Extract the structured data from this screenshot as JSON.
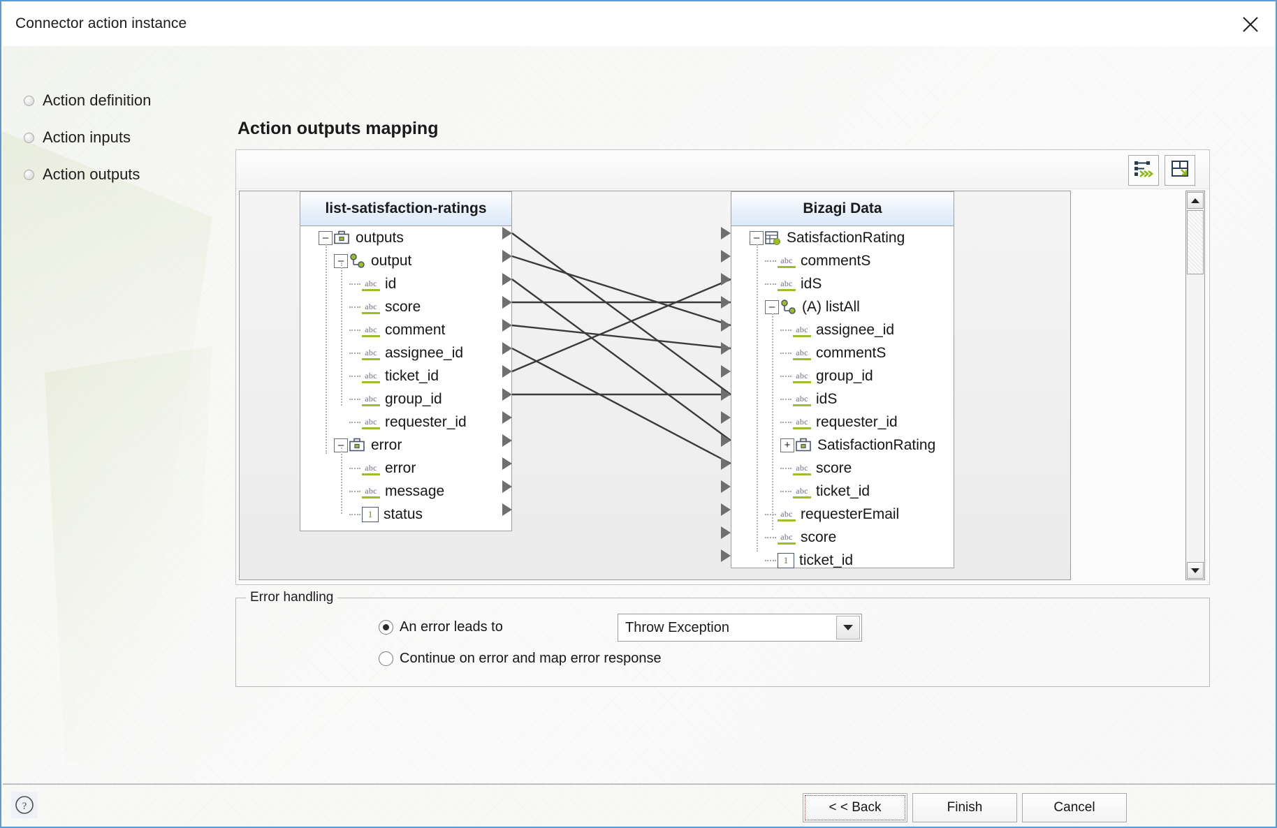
{
  "window": {
    "title": "Connector action instance",
    "close_icon": "close-icon"
  },
  "wizard_nav": {
    "items": [
      {
        "label": "Action definition"
      },
      {
        "label": "Action inputs"
      },
      {
        "label": "Action outputs"
      }
    ]
  },
  "page": {
    "title": "Action outputs mapping"
  },
  "mapper_toolbar": {
    "buttons": [
      {
        "icon": "auto-map-icon",
        "label": ""
      },
      {
        "icon": "fit-to-window-icon",
        "label": ""
      }
    ]
  },
  "source_tree": {
    "header": "list-satisfaction-ratings",
    "nodes": [
      {
        "label": "outputs",
        "indent": 0,
        "icon": "briefcase-icon",
        "expander": "minus"
      },
      {
        "label": "output",
        "indent": 1,
        "icon": "object-node-icon",
        "expander": "minus"
      },
      {
        "label": "id",
        "indent": 2,
        "icon": "abc-icon",
        "expander": "none"
      },
      {
        "label": "score",
        "indent": 2,
        "icon": "abc-icon",
        "expander": "none"
      },
      {
        "label": "comment",
        "indent": 2,
        "icon": "abc-icon",
        "expander": "none"
      },
      {
        "label": "assignee_id",
        "indent": 2,
        "icon": "abc-icon",
        "expander": "none"
      },
      {
        "label": "ticket_id",
        "indent": 2,
        "icon": "abc-icon",
        "expander": "none"
      },
      {
        "label": "group_id",
        "indent": 2,
        "icon": "abc-icon",
        "expander": "none"
      },
      {
        "label": "requester_id",
        "indent": 2,
        "icon": "abc-icon",
        "expander": "none"
      },
      {
        "label": "error",
        "indent": 1,
        "icon": "briefcase-icon",
        "expander": "minus"
      },
      {
        "label": "error",
        "indent": 2,
        "icon": "abc-icon",
        "expander": "none"
      },
      {
        "label": "message",
        "indent": 2,
        "icon": "abc-icon",
        "expander": "none"
      },
      {
        "label": "status",
        "indent": 2,
        "icon": "number-icon",
        "expander": "none"
      }
    ]
  },
  "target_tree": {
    "header": "Bizagi Data",
    "nodes": [
      {
        "label": "SatisfactionRating",
        "indent": 0,
        "icon": "entity-icon",
        "expander": "minus"
      },
      {
        "label": "commentS",
        "indent": 1,
        "icon": "abc-icon",
        "expander": "none"
      },
      {
        "label": "idS",
        "indent": 1,
        "icon": "abc-icon",
        "expander": "none"
      },
      {
        "label": "(A) listAll",
        "indent": 1,
        "icon": "object-node-icon",
        "expander": "minus"
      },
      {
        "label": "assignee_id",
        "indent": 2,
        "icon": "abc-icon",
        "expander": "none"
      },
      {
        "label": "commentS",
        "indent": 2,
        "icon": "abc-icon",
        "expander": "none"
      },
      {
        "label": "group_id",
        "indent": 2,
        "icon": "abc-icon",
        "expander": "none"
      },
      {
        "label": "idS",
        "indent": 2,
        "icon": "abc-icon",
        "expander": "none"
      },
      {
        "label": "requester_id",
        "indent": 2,
        "icon": "abc-icon",
        "expander": "none"
      },
      {
        "label": "SatisfactionRating",
        "indent": 2,
        "icon": "briefcase-icon",
        "expander": "plus"
      },
      {
        "label": "score",
        "indent": 2,
        "icon": "abc-icon",
        "expander": "none"
      },
      {
        "label": "ticket_id",
        "indent": 2,
        "icon": "abc-icon",
        "expander": "none"
      },
      {
        "label": "requesterEmail",
        "indent": 1,
        "icon": "abc-icon",
        "expander": "none"
      },
      {
        "label": "score",
        "indent": 1,
        "icon": "abc-icon",
        "expander": "none"
      },
      {
        "label": "ticket_id",
        "indent": 1,
        "icon": "number-icon",
        "expander": "none"
      }
    ]
  },
  "mappings": [
    {
      "from": "output",
      "to": "score"
    },
    {
      "from": "id",
      "to": "idS"
    },
    {
      "from": "score",
      "to": "assignee_id"
    },
    {
      "from": "comment",
      "to": "commentS"
    },
    {
      "from": "assignee_id",
      "to": "group_id"
    },
    {
      "from": "ticket_id",
      "to": "score"
    },
    {
      "from": "group_id",
      "to": "ticket_id"
    },
    {
      "from": "requester_id",
      "to": "requester_id"
    }
  ],
  "scrollbar": {
    "up_icon": "arrow-up-icon",
    "down_icon": "arrow-down-icon",
    "thumb_position_percent": 5
  },
  "error_handling": {
    "legend": "Error handling",
    "option_error_leads_to": "An error leads to",
    "option_continue": "Continue on error and map error response",
    "selected": "An error leads to",
    "dropdown": {
      "value": "Throw Exception",
      "arrow_icon": "chevron-down-icon"
    }
  },
  "footer": {
    "help_icon": "help-icon",
    "back_label": "< < Back",
    "finish_label": "Finish",
    "cancel_label": "Cancel"
  },
  "colors": {
    "accent_border": "#5b9bd5",
    "tree_header": "#dce9f8",
    "icon_green": "#9dbd2e",
    "line": "#3a3a3a"
  }
}
